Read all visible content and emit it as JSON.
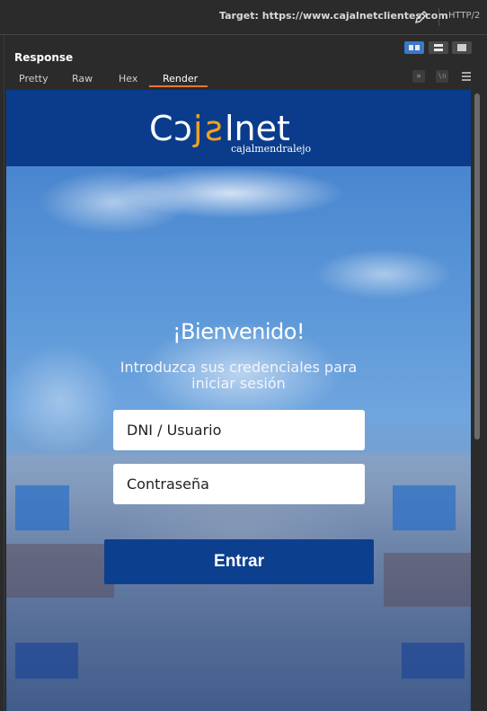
{
  "target": {
    "label": "Target: https://www.cajalnetclientes.com",
    "protocol": "HTTP/2"
  },
  "panel": {
    "title": "Response"
  },
  "tabs": [
    {
      "label": "Pretty"
    },
    {
      "label": "Raw"
    },
    {
      "label": "Hex"
    },
    {
      "label": "Render",
      "active": true
    }
  ],
  "tool_icons": {
    "wrap": "≡",
    "newline": "\\n"
  },
  "site": {
    "logo_text": "Cajalnet",
    "logo_tagline": "cajalmendralejo",
    "welcome": "¡Bienvenido!",
    "subtitle": "Introduzca sus credenciales para iniciar sesión",
    "user_placeholder": "DNI / Usuario",
    "password_placeholder": "Contraseña",
    "submit_label": "Entrar"
  },
  "colors": {
    "header_bg": "#0b3c8c",
    "accent_orange": "#e8772e",
    "button_bg": "#0d3f8f",
    "tab_active_underline": "#e8772e",
    "logo_j": "#f0a21f"
  }
}
